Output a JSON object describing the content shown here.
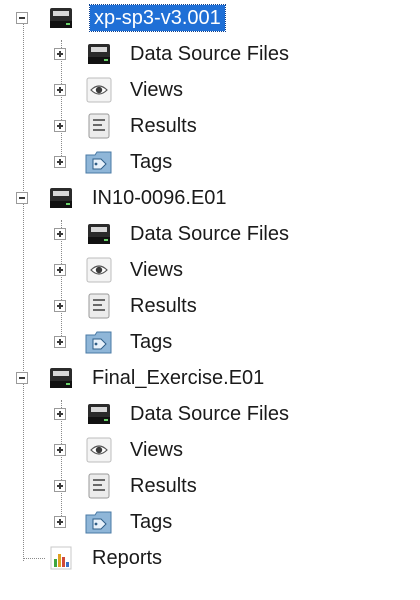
{
  "tree": {
    "data_sources": [
      {
        "name": "xp-sp3-v3.001",
        "selected": true,
        "children": {
          "data_source_files": "Data Source Files",
          "views": "Views",
          "results": "Results",
          "tags": "Tags"
        }
      },
      {
        "name": "IN10-0096.E01",
        "selected": false,
        "children": {
          "data_source_files": "Data Source Files",
          "views": "Views",
          "results": "Results",
          "tags": "Tags"
        }
      },
      {
        "name": "Final_Exercise.E01",
        "selected": false,
        "children": {
          "data_source_files": "Data Source Files",
          "views": "Views",
          "results": "Results",
          "tags": "Tags"
        }
      }
    ],
    "reports": "Reports"
  },
  "colors": {
    "selection": "#1f6fd6",
    "tags_folder": "#8fb6d8"
  },
  "icons": {
    "disk": "disk-drive-icon",
    "views": "eye-icon",
    "results": "document-list-icon",
    "tags": "tag-folder-icon",
    "reports": "bar-chart-report-icon"
  }
}
